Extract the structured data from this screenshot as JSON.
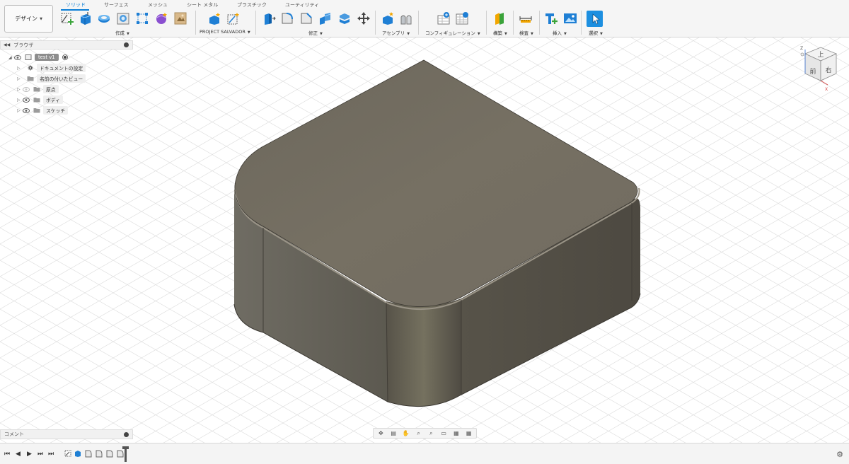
{
  "workspace": {
    "label": "デザイン"
  },
  "tabs": [
    {
      "label": "ソリッド",
      "active": true
    },
    {
      "label": "サーフェス",
      "active": false
    },
    {
      "label": "メッシュ",
      "active": false
    },
    {
      "label": "シート メタル",
      "active": false
    },
    {
      "label": "プラスチック",
      "active": false
    },
    {
      "label": "ユーティリティ",
      "active": false
    }
  ],
  "toolbar_groups": {
    "create": "作成",
    "project": "PROJECT SALVADOR",
    "modify": "修正",
    "assemble": "アセンブリ",
    "configure": "コンフィギュレーション",
    "construct": "構築",
    "inspect": "検査",
    "insert": "挿入",
    "select": "選択"
  },
  "browser": {
    "title": "ブラウザ",
    "root": "test v1",
    "items": [
      {
        "label": "ドキュメントの設定",
        "icon": "gear-icon"
      },
      {
        "label": "名前の付いたビュー",
        "icon": "folder-icon"
      },
      {
        "label": "原点",
        "icon": "folder-icon",
        "visible": false
      },
      {
        "label": "ボディ",
        "icon": "folder-icon",
        "visible": true
      },
      {
        "label": "スケッチ",
        "icon": "folder-icon",
        "visible": true
      }
    ]
  },
  "comments": {
    "title": "コメント"
  },
  "viewcube": {
    "top": "上",
    "front": "前",
    "right": "右",
    "axis_z": "Z",
    "axis_x": "X"
  },
  "colors": {
    "accent": "#0a7ed6",
    "body": "#7a7468"
  }
}
